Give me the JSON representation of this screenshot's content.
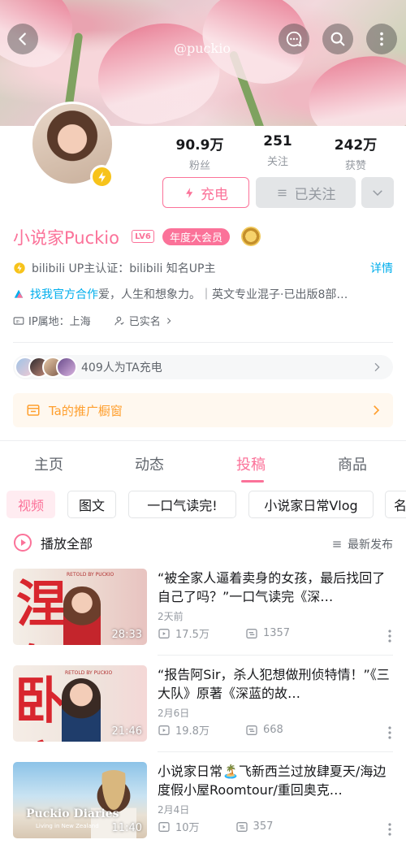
{
  "banner": {
    "watermark": "@puckio"
  },
  "stats": [
    {
      "value": "90.9万",
      "label": "粉丝"
    },
    {
      "value": "251",
      "label": "关注"
    },
    {
      "value": "242万",
      "label": "获赞"
    }
  ],
  "actions": {
    "charge": "充电",
    "followed": "已关注"
  },
  "profile": {
    "name": "小说家Puckio",
    "level": "LV6",
    "vip": "年度大会员",
    "certification": "bilibili UP主认证：bilibili 知名UP主",
    "detail": "详情",
    "bio_link": "找我官方合作",
    "bio_rest": "爱，人生和想象力。｜英文专业混子·已出版8部…",
    "ip": "IP属地：上海",
    "realname": "已实名"
  },
  "chargers": {
    "text": "409人为TA充电"
  },
  "shop": {
    "text": "Ta的推广橱窗"
  },
  "tabs": [
    "主页",
    "动态",
    "投稿",
    "商品"
  ],
  "chips": [
    "视频",
    "图文",
    "一口气读完!",
    "小说家日常Vlog",
    "名"
  ],
  "list": {
    "play_all": "播放全部",
    "sort": "最新发布"
  },
  "videos": [
    {
      "title": "“被全家人逼着卖身的女孩，最后找回了自己了吗？”一口气读完《深…",
      "date": "2天前",
      "views": "17.5万",
      "comments": "1357",
      "duration": "28:33",
      "thumb_text": "涅槃",
      "thumb_sub": "RETOLD BY PUCKIO"
    },
    {
      "title": "“报告阿Sir，杀人犯想做刑侦特情！”《三大队》原著《深蓝的故…",
      "date": "2月6日",
      "views": "19.8万",
      "comments": "668",
      "duration": "21:46",
      "thumb_text": "卧底",
      "thumb_sub": "RETOLD BY PUCKIO"
    },
    {
      "title": "小说家日常🏝️飞新西兰过放肆夏天/海边度假小屋Roomtour/重回奥克…",
      "date": "2月4日",
      "views": "10万",
      "comments": "357",
      "duration": "11:40",
      "thumb_text": "Puckio Diaries",
      "thumb_sub": "Living in New Zealand"
    }
  ],
  "colors": {
    "accent": "#fb7299",
    "link": "#00aeec",
    "shop": "#ff9f2e"
  }
}
